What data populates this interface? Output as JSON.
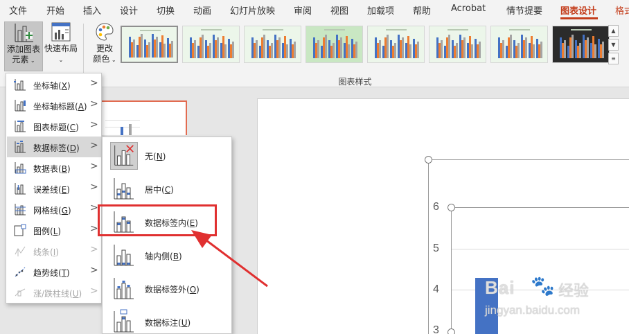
{
  "ribbon_tabs": [
    {
      "label": "文件"
    },
    {
      "label": "开始"
    },
    {
      "label": "插入"
    },
    {
      "label": "设计"
    },
    {
      "label": "切换"
    },
    {
      "label": "动画"
    },
    {
      "label": "幻灯片放映"
    },
    {
      "label": "审阅"
    },
    {
      "label": "视图"
    },
    {
      "label": "加载项"
    },
    {
      "label": "帮助"
    },
    {
      "label": "Acrobat"
    },
    {
      "label": "情节提要"
    },
    {
      "label": "图表设计"
    },
    {
      "label": "格式"
    }
  ],
  "active_tab": "图表设计",
  "ribbon": {
    "add_chart_element_line1": "添加图表",
    "add_chart_element_line2": "元素",
    "quick_layout": "快速布局",
    "change_colors_line1": "更改",
    "change_colors_line2": "颜色",
    "chart_styles_group": "图表样式",
    "chart_style_count": 8,
    "selected_style_index": 0
  },
  "menu": {
    "items": [
      {
        "label": "坐标轴",
        "key": "X",
        "icon": "axes-icon",
        "enabled": true
      },
      {
        "label": "坐标轴标题",
        "key": "A",
        "icon": "axis-titles-icon",
        "enabled": true
      },
      {
        "label": "图表标题",
        "key": "C",
        "icon": "chart-title-icon",
        "enabled": true
      },
      {
        "label": "数据标签",
        "key": "D",
        "icon": "data-labels-icon",
        "enabled": true,
        "highlighted": true
      },
      {
        "label": "数据表",
        "key": "B",
        "icon": "data-table-icon",
        "enabled": true
      },
      {
        "label": "误差线",
        "key": "E",
        "icon": "error-bars-icon",
        "enabled": true
      },
      {
        "label": "网格线",
        "key": "G",
        "icon": "gridlines-icon",
        "enabled": true
      },
      {
        "label": "图例",
        "key": "L",
        "icon": "legend-icon",
        "enabled": true
      },
      {
        "label": "线条",
        "key": "I",
        "icon": "lines-icon",
        "enabled": false
      },
      {
        "label": "趋势线",
        "key": "T",
        "icon": "trendline-icon",
        "enabled": true
      },
      {
        "label": "涨/跌柱线",
        "key": "U",
        "icon": "up-down-bars-icon",
        "enabled": false
      }
    ]
  },
  "submenu": {
    "items": [
      {
        "label": "无",
        "key": "N"
      },
      {
        "label": "居中",
        "key": "C"
      },
      {
        "label": "数据标签内",
        "key": "E"
      },
      {
        "label": "轴内侧",
        "key": "B"
      },
      {
        "label": "数据标签外",
        "key": "O"
      },
      {
        "label": "数据标注",
        "key": "U"
      }
    ],
    "highlighted_index": 2
  },
  "chart": {
    "y_ticks": [
      "6",
      "5",
      "4",
      "3"
    ],
    "bar_color": "#4472c4"
  },
  "watermark": {
    "logo": "Bai",
    "paw": "🐾",
    "brand": "经验",
    "url": "jingyan.baidu.com"
  },
  "colors": {
    "accent": "#c43e1c",
    "annotation_red": "#e03030",
    "series_blue": "#4472c4",
    "series_orange": "#ed7d31",
    "series_gray": "#a5a5a5"
  }
}
